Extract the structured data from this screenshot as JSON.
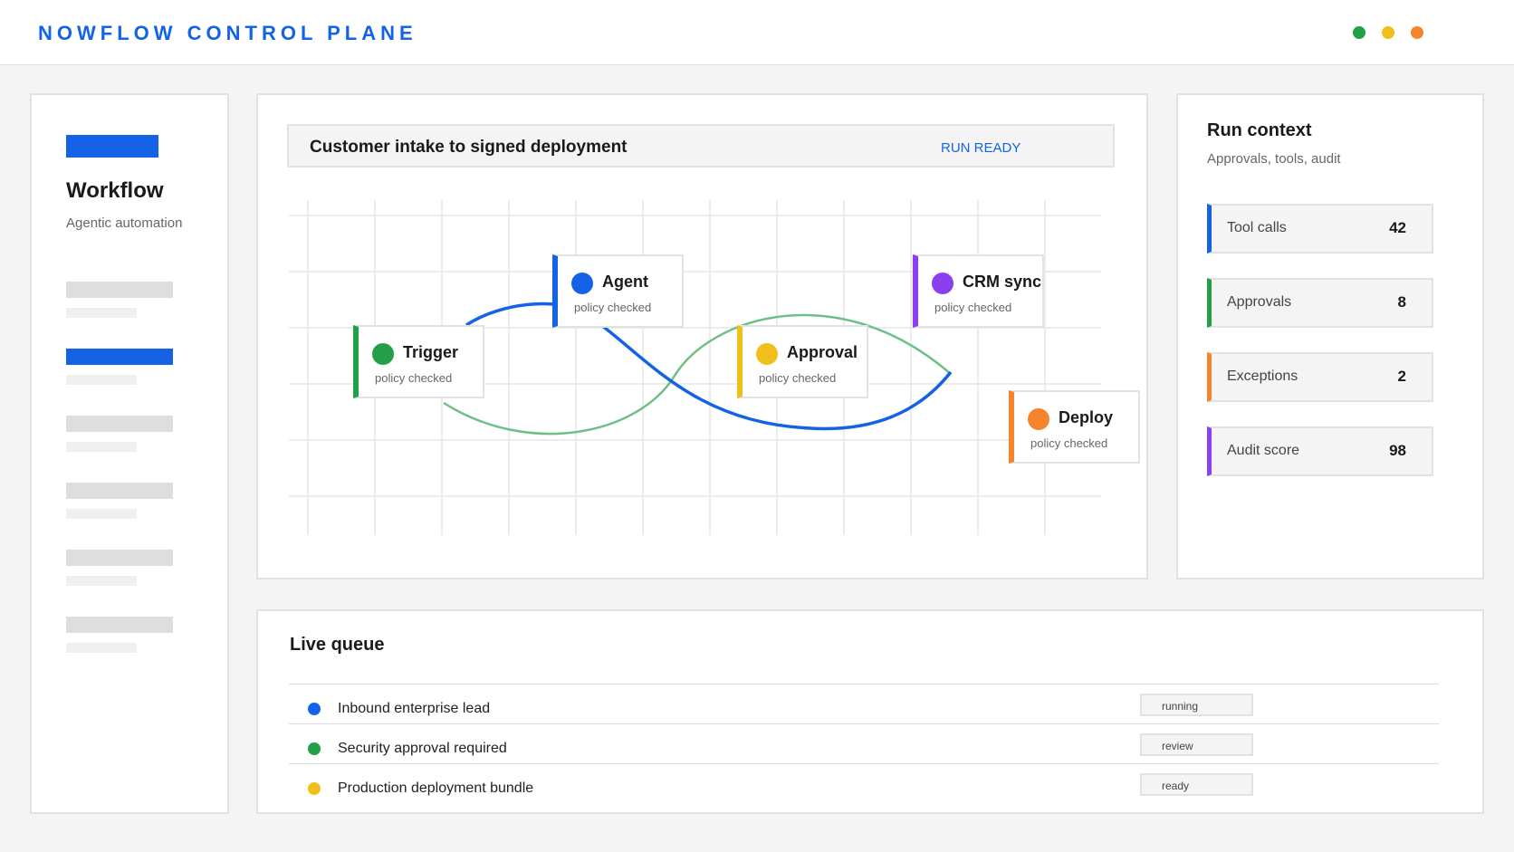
{
  "app": {
    "title": "NOWFLOW CONTROL PLANE",
    "window_dots": [
      {
        "name": "green",
        "color": "#23a047"
      },
      {
        "name": "yellow",
        "color": "#f0bf1a"
      },
      {
        "name": "orange",
        "color": "#f5842c"
      }
    ]
  },
  "sidebar": {
    "title": "Workflow",
    "subtitle": "Agentic automation",
    "active_item_index": 1,
    "item_count": 6
  },
  "flow": {
    "title": "Customer intake to signed deployment",
    "status": "RUN READY",
    "nodes": [
      {
        "label": "Trigger",
        "sub": "policy checked",
        "color": "#23a047"
      },
      {
        "label": "Agent",
        "sub": "policy checked",
        "color": "#1463e6"
      },
      {
        "label": "Approval",
        "sub": "policy checked",
        "color": "#f0bf1a"
      },
      {
        "label": "CRM sync",
        "sub": "policy checked",
        "color": "#8a3ff0"
      },
      {
        "label": "Deploy",
        "sub": "policy checked",
        "color": "#f5842c"
      }
    ],
    "connectors": [
      {
        "name": "primary-path",
        "color": "#1463e6"
      },
      {
        "name": "secondary-path",
        "color": "#6cc085"
      }
    ]
  },
  "run_context": {
    "title": "Run context",
    "subtitle": "Approvals, tools, audit",
    "stats": [
      {
        "label": "Tool calls",
        "value": "42",
        "color": "#1463e6"
      },
      {
        "label": "Approvals",
        "value": "8",
        "color": "#23a047"
      },
      {
        "label": "Exceptions",
        "value": "2",
        "color": "#f5842c"
      },
      {
        "label": "Audit score",
        "value": "98",
        "color": "#8a3ff0"
      }
    ]
  },
  "queue": {
    "title": "Live queue",
    "items": [
      {
        "label": "Inbound enterprise lead",
        "status": "running",
        "color": "#1463e6"
      },
      {
        "label": "Security approval required",
        "status": "review",
        "color": "#23a047"
      },
      {
        "label": "Production deployment bundle",
        "status": "ready",
        "color": "#f0bf1a"
      }
    ]
  }
}
